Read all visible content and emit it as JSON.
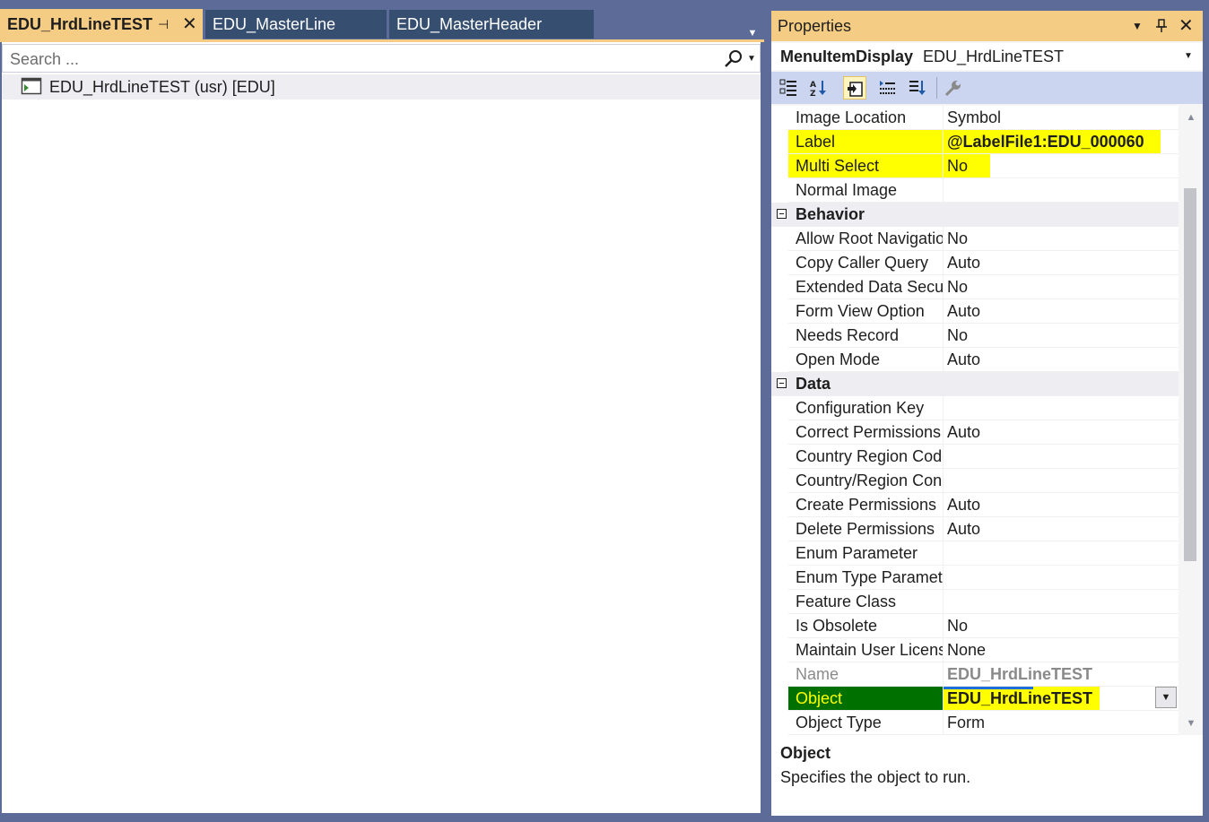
{
  "doc_tabs": [
    {
      "label": "EDU_HrdLineTEST",
      "active": true
    },
    {
      "label": "EDU_MasterLine",
      "active": false
    },
    {
      "label": "EDU_MasterHeader",
      "active": false
    }
  ],
  "icons": {
    "pin": "⊣",
    "close": "✕",
    "overflow": "▼",
    "dropdown": "▼",
    "scroll_up": "▲",
    "scroll_down": "▼"
  },
  "search": {
    "placeholder": "Search ..."
  },
  "tree": {
    "item_label": "EDU_HrdLineTEST (usr) [EDU]"
  },
  "properties": {
    "title": "Properties",
    "object_type": "MenuItemDisplay",
    "object_name": "EDU_HrdLineTEST",
    "rows": [
      {
        "kind": "prop",
        "key": "Image Location",
        "value": "Symbol"
      },
      {
        "kind": "prop",
        "key": "Label",
        "value": "@LabelFile1:EDU_000060",
        "highlight": true,
        "bold": true
      },
      {
        "kind": "prop",
        "key": "Multi Select",
        "value": "No",
        "highlight": true
      },
      {
        "kind": "prop",
        "key": "Normal Image",
        "value": ""
      },
      {
        "kind": "cat",
        "key": "Behavior"
      },
      {
        "kind": "prop",
        "key": "Allow Root Navigatio",
        "value": "No"
      },
      {
        "kind": "prop",
        "key": "Copy Caller Query",
        "value": "Auto"
      },
      {
        "kind": "prop",
        "key": "Extended Data Secur",
        "value": "No"
      },
      {
        "kind": "prop",
        "key": "Form View Option",
        "value": "Auto"
      },
      {
        "kind": "prop",
        "key": "Needs Record",
        "value": "No"
      },
      {
        "kind": "prop",
        "key": "Open Mode",
        "value": "Auto"
      },
      {
        "kind": "cat",
        "key": "Data"
      },
      {
        "kind": "prop",
        "key": "Configuration Key",
        "value": ""
      },
      {
        "kind": "prop",
        "key": "Correct Permissions",
        "value": "Auto"
      },
      {
        "kind": "prop",
        "key": "Country Region Code",
        "value": ""
      },
      {
        "kind": "prop",
        "key": "Country/Region Con",
        "value": ""
      },
      {
        "kind": "prop",
        "key": "Create Permissions",
        "value": "Auto"
      },
      {
        "kind": "prop",
        "key": "Delete Permissions",
        "value": "Auto"
      },
      {
        "kind": "prop",
        "key": "Enum Parameter",
        "value": ""
      },
      {
        "kind": "prop",
        "key": "Enum Type Paramete",
        "value": ""
      },
      {
        "kind": "prop",
        "key": "Feature Class",
        "value": ""
      },
      {
        "kind": "prop",
        "key": "Is Obsolete",
        "value": "No"
      },
      {
        "kind": "prop",
        "key": "Maintain User Licens",
        "value": "None"
      },
      {
        "kind": "prop",
        "key": "Name",
        "value": "EDU_HrdLineTEST",
        "grey": true,
        "bold": true
      },
      {
        "kind": "prop",
        "key": "Object",
        "value": "EDU_HrdLineTEST",
        "selected": true,
        "highlight": true,
        "bold": true
      },
      {
        "kind": "prop",
        "key": "Object Type",
        "value": "Form"
      }
    ],
    "description_title": "Object",
    "description_text": "Specifies the object to run."
  },
  "colors": {
    "active_tab": "#f5cc84",
    "highlight": "#ffff00",
    "selected_key": "#007000",
    "selected_bar": "#1e6fd9"
  }
}
